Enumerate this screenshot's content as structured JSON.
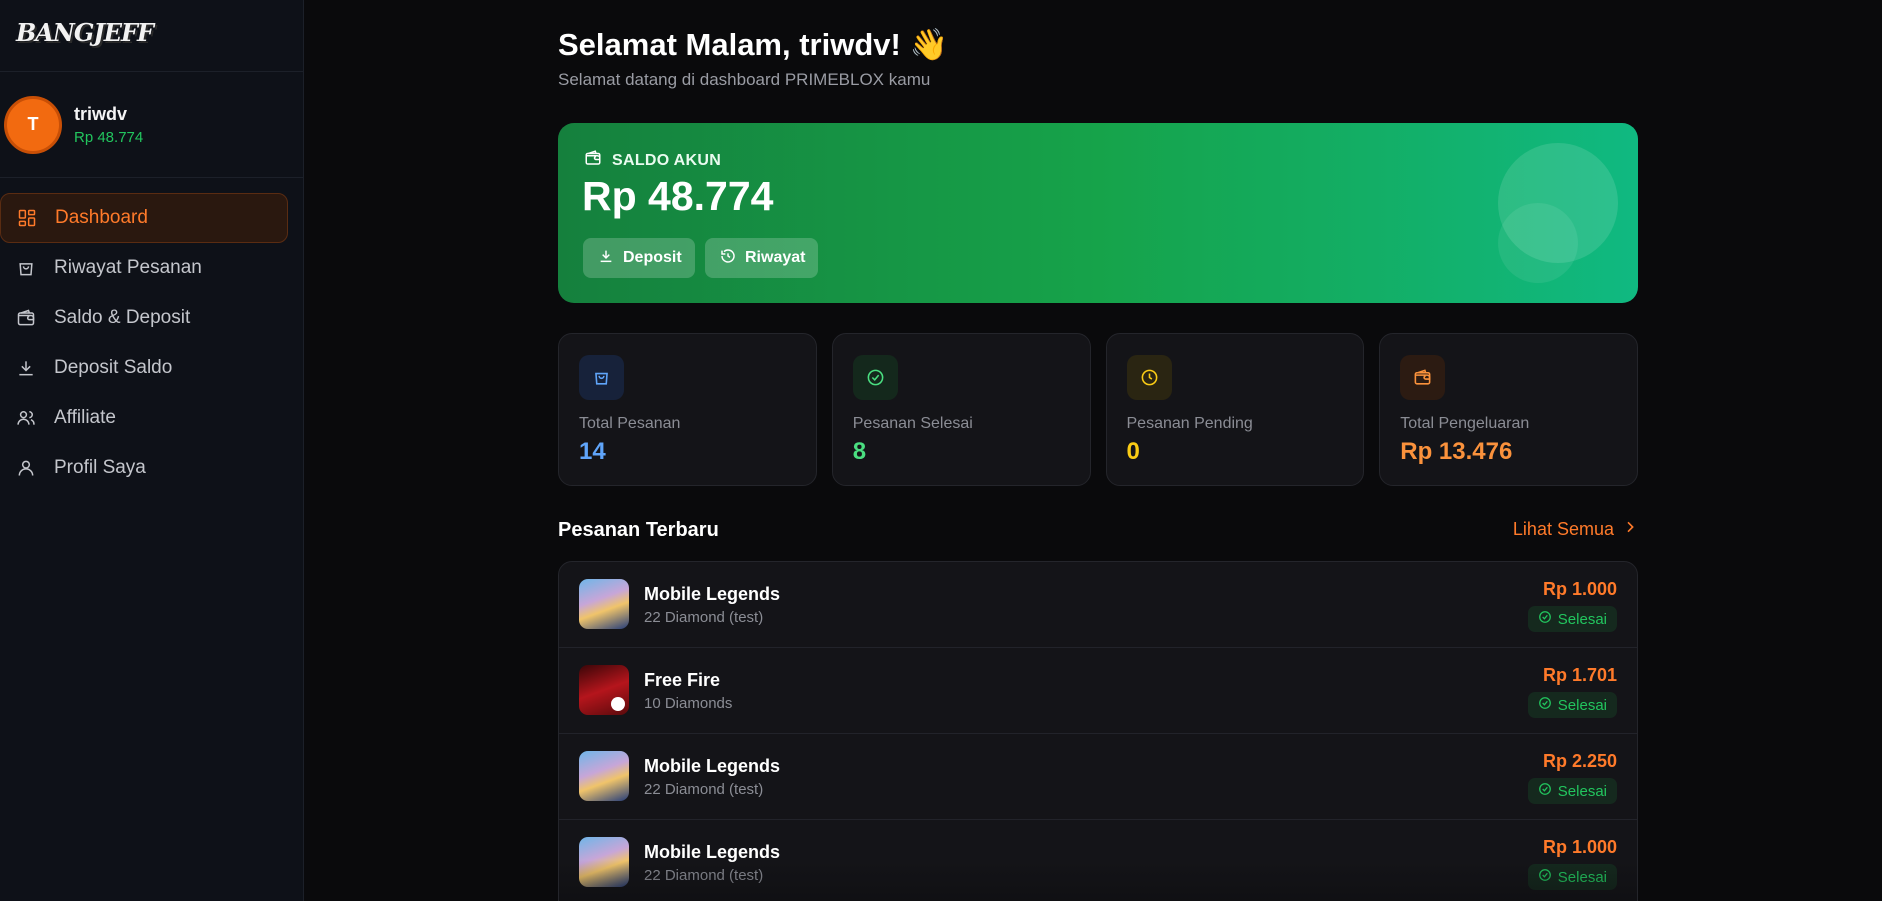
{
  "brand": {
    "logo_text": "BANGJEFF"
  },
  "user": {
    "initial": "T",
    "name": "triwdv",
    "balance": "Rp 48.774"
  },
  "sidebar": {
    "items": [
      {
        "label": "Dashboard",
        "icon": "dashboard-icon",
        "active": true
      },
      {
        "label": "Riwayat Pesanan",
        "icon": "shopping-bag-icon"
      },
      {
        "label": "Saldo & Deposit",
        "icon": "wallet-icon"
      },
      {
        "label": "Deposit Saldo",
        "icon": "download-icon"
      },
      {
        "label": "Affiliate",
        "icon": "users-icon"
      },
      {
        "label": "Profil Saya",
        "icon": "user-icon"
      }
    ]
  },
  "header": {
    "greeting": "Selamat Malam, triwdv! 👋",
    "subtitle": "Selamat datang di dashboard PRIMEBLOX kamu"
  },
  "balance_card": {
    "label": "SALDO AKUN",
    "amount": "Rp 48.774",
    "deposit_label": "Deposit",
    "history_label": "Riwayat"
  },
  "stats": [
    {
      "label": "Total Pesanan",
      "value": "14",
      "color": "#60a5fa",
      "icon": "bag-icon"
    },
    {
      "label": "Pesanan Selesai",
      "value": "8",
      "color": "#4ade80",
      "icon": "check-circle-icon"
    },
    {
      "label": "Pesanan Pending",
      "value": "0",
      "color": "#facc15",
      "icon": "clock-icon"
    },
    {
      "label": "Total Pengeluaran",
      "value": "Rp 13.476",
      "color": "#fb923c",
      "icon": "wallet-icon"
    }
  ],
  "recent": {
    "title": "Pesanan Terbaru",
    "see_all": "Lihat Semua",
    "orders": [
      {
        "game": "Mobile Legends",
        "item": "22 Diamond (test)",
        "price": "Rp 1.000",
        "status": "Selesai"
      },
      {
        "game": "Free Fire",
        "item": "10 Diamonds",
        "price": "Rp 1.701",
        "status": "Selesai"
      },
      {
        "game": "Mobile Legends",
        "item": "22 Diamond (test)",
        "price": "Rp 2.250",
        "status": "Selesai"
      },
      {
        "game": "Mobile Legends",
        "item": "22 Diamond (test)",
        "price": "Rp 1.000",
        "status": "Selesai"
      }
    ]
  }
}
